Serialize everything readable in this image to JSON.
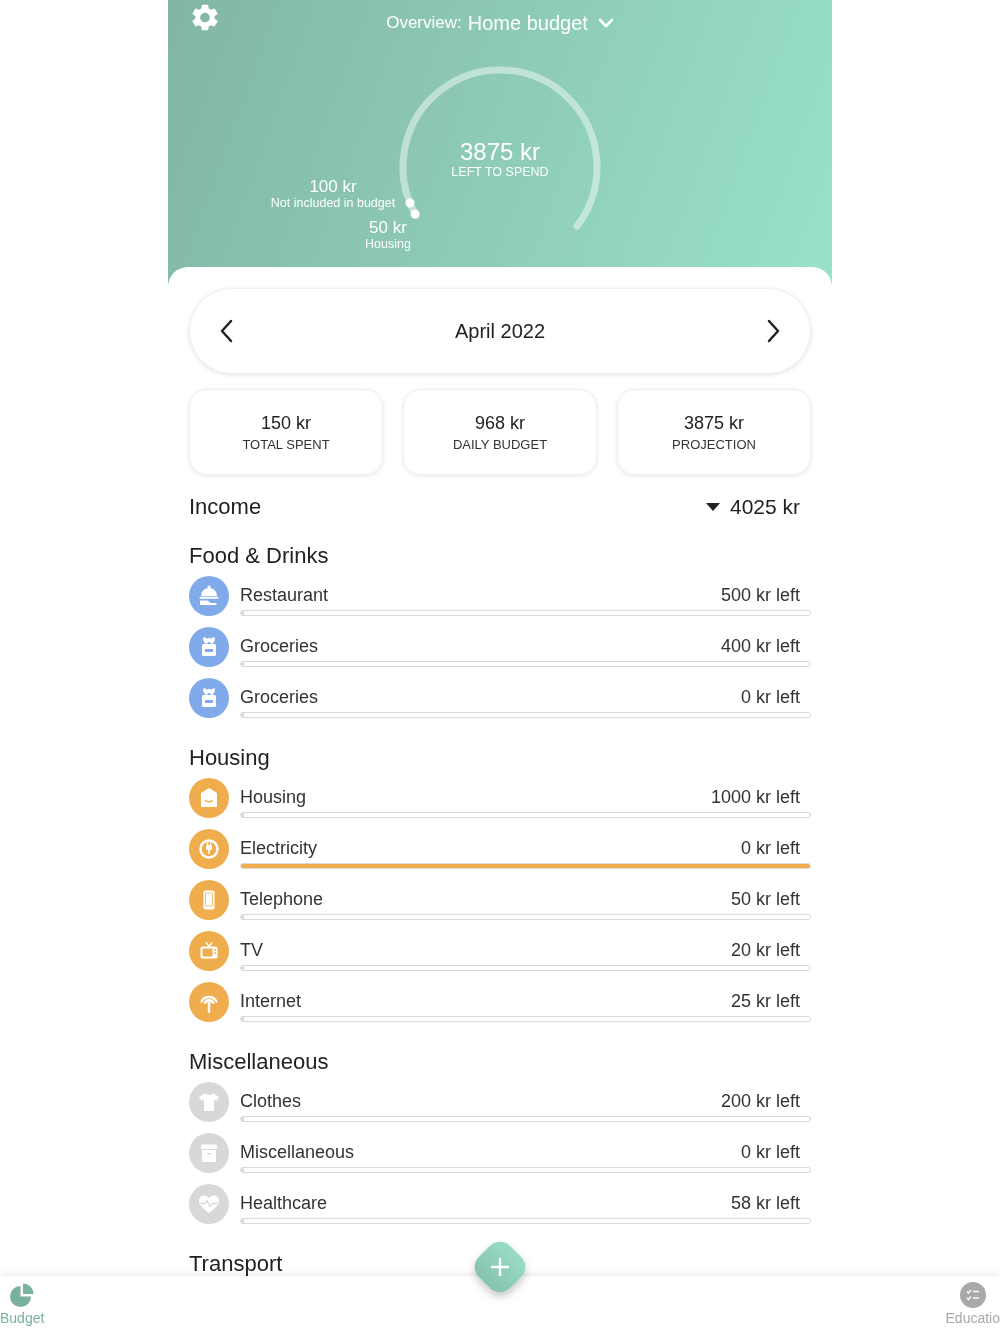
{
  "header": {
    "title_prefix": "Overview:",
    "title": "Home budget",
    "gauge": {
      "amount": "3875 kr",
      "caption": "LEFT TO SPEND",
      "markers": [
        {
          "amount": "100 kr",
          "label": "Not included in budget"
        },
        {
          "amount": "50 kr",
          "label": "Housing"
        }
      ]
    }
  },
  "period": {
    "label": "April 2022"
  },
  "summary": [
    {
      "value": "150 kr",
      "label": "TOTAL SPENT"
    },
    {
      "value": "968 kr",
      "label": "DAILY BUDGET"
    },
    {
      "value": "3875 kr",
      "label": "PROJECTION"
    }
  ],
  "income": {
    "label": "Income",
    "amount": "4025 kr"
  },
  "sections": [
    {
      "title": "Food & Drinks",
      "color": "#80aaea",
      "items": [
        {
          "kind": "restaurant",
          "name": "Restaurant",
          "remaining": "500 kr left",
          "level": 0
        },
        {
          "kind": "groceries",
          "name": "Groceries",
          "remaining": "400 kr left",
          "level": 0
        },
        {
          "kind": "groceries",
          "name": "Groceries",
          "remaining": "0 kr left",
          "level": 0
        }
      ]
    },
    {
      "title": "Housing",
      "color": "#f0ad4e",
      "items": [
        {
          "kind": "housing",
          "name": "Housing",
          "remaining": "1000 kr left",
          "level": 0
        },
        {
          "kind": "electricity",
          "name": "Electricity",
          "remaining": "0 kr left",
          "level": 1
        },
        {
          "kind": "telephone",
          "name": "Telephone",
          "remaining": "50 kr left",
          "level": 0
        },
        {
          "kind": "tv",
          "name": "TV",
          "remaining": "20 kr left",
          "level": 0
        },
        {
          "kind": "internet",
          "name": "Internet",
          "remaining": "25 kr left",
          "level": 0
        }
      ]
    },
    {
      "title": "Miscellaneous",
      "color": "#d8d8d8",
      "items": [
        {
          "kind": "clothes",
          "name": "Clothes",
          "remaining": "200 kr left",
          "level": 0
        },
        {
          "kind": "miscellaneous",
          "name": "Miscellaneous",
          "remaining": "0 kr left",
          "level": 0
        },
        {
          "kind": "healthcare",
          "name": "Healthcare",
          "remaining": "58 kr left",
          "level": 0
        }
      ]
    },
    {
      "title": "Transport"
    }
  ],
  "nav": [
    {
      "kind": "budget",
      "label": "Budget",
      "selected": true
    },
    {
      "kind": "education",
      "label": "Educatio",
      "selected": false
    }
  ]
}
